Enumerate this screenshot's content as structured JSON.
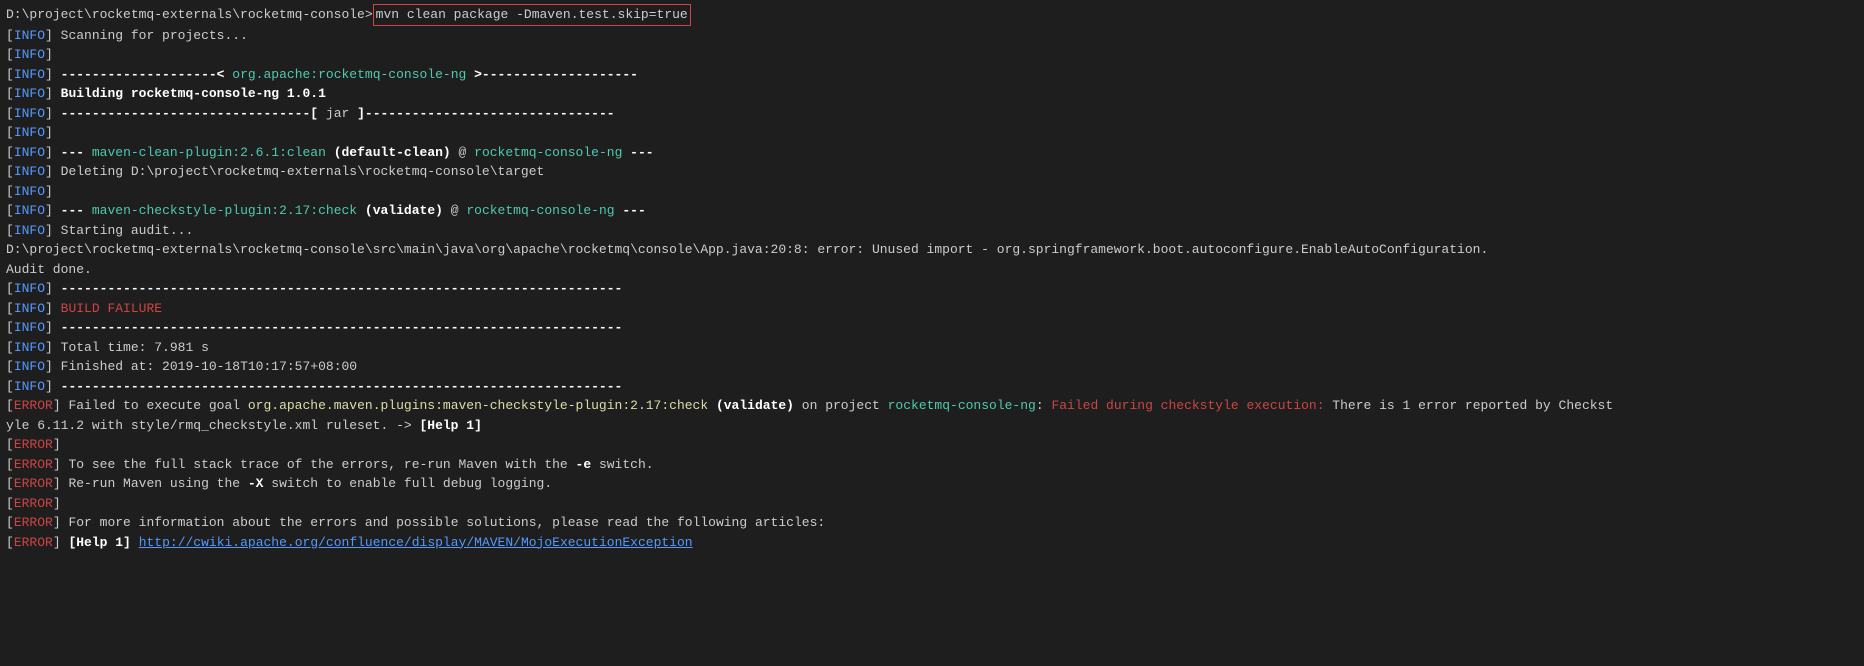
{
  "prompt_path": "D:\\project\\rocketmq-externals\\rocketmq-console>",
  "command": "mvn clean package -Dmaven.test.skip=true",
  "tags": {
    "info": "INFO",
    "error": "ERROR"
  },
  "lines": {
    "scanning": " Scanning for projects...",
    "rule1_pre": " --------------------< ",
    "artifact": "org.apache:rocketmq-console-ng",
    "rule1_post": " >--------------------",
    "building": " Building rocketmq-console-ng 1.0.1",
    "rule2_pre": " --------------------------------[ ",
    "jar": "jar",
    "rule2_post": " ]--------------------------------",
    "clean_pre": " --- ",
    "clean_plugin": "maven-clean-plugin:2.6.1:clean",
    "clean_goal": " (default-clean)",
    "at": " @ ",
    "project_name": "rocketmq-console-ng",
    "dashes_post": " ---",
    "deleting": " Deleting D:\\project\\rocketmq-externals\\rocketmq-console\\target",
    "checkstyle_plugin": "maven-checkstyle-plugin:2.17:check",
    "validate": " (validate)",
    "starting_audit": " Starting audit...",
    "error_java": "D:\\project\\rocketmq-externals\\rocketmq-console\\src\\main\\java\\org\\apache\\rocketmq\\console\\App.java:20:8: error: Unused import - org.springframework.boot.autoconfigure.EnableAutoConfiguration.",
    "audit_done": "Audit done.",
    "hr": " ------------------------------------------------------------------------",
    "build_failure": " BUILD FAILURE",
    "total_time": " Total time:  7.981 s",
    "finished_at": " Finished at: 2019-10-18T10:17:57+08:00",
    "err_failed_pre": " Failed to execute goal ",
    "err_plugin": "org.apache.maven.plugins:maven-checkstyle-plugin:2.17:check",
    "err_validate": " (validate)",
    "err_on_project": " on project ",
    "err_colon": ": ",
    "err_failed_msg": "Failed during checkstyle execution:",
    "err_tail": " There is 1 error reported by Checkst",
    "err_line2": "yle 6.11.2 with style/rmq_checkstyle.xml ruleset. -> ",
    "help1": "[Help 1]",
    "err_trace": " To see the full stack trace of the errors, re-run Maven with the ",
    "eswitch": "-e",
    "switch_text": " switch.",
    "err_rerun": " Re-run Maven using the ",
    "xswitch": "-X",
    "debug_text": " switch to enable full debug logging.",
    "err_more": " For more information about the errors and possible solutions, please read the following articles:",
    "help1_pre": " ",
    "help_link": "http://cwiki.apache.org/confluence/display/MAVEN/MojoExecutionException"
  }
}
